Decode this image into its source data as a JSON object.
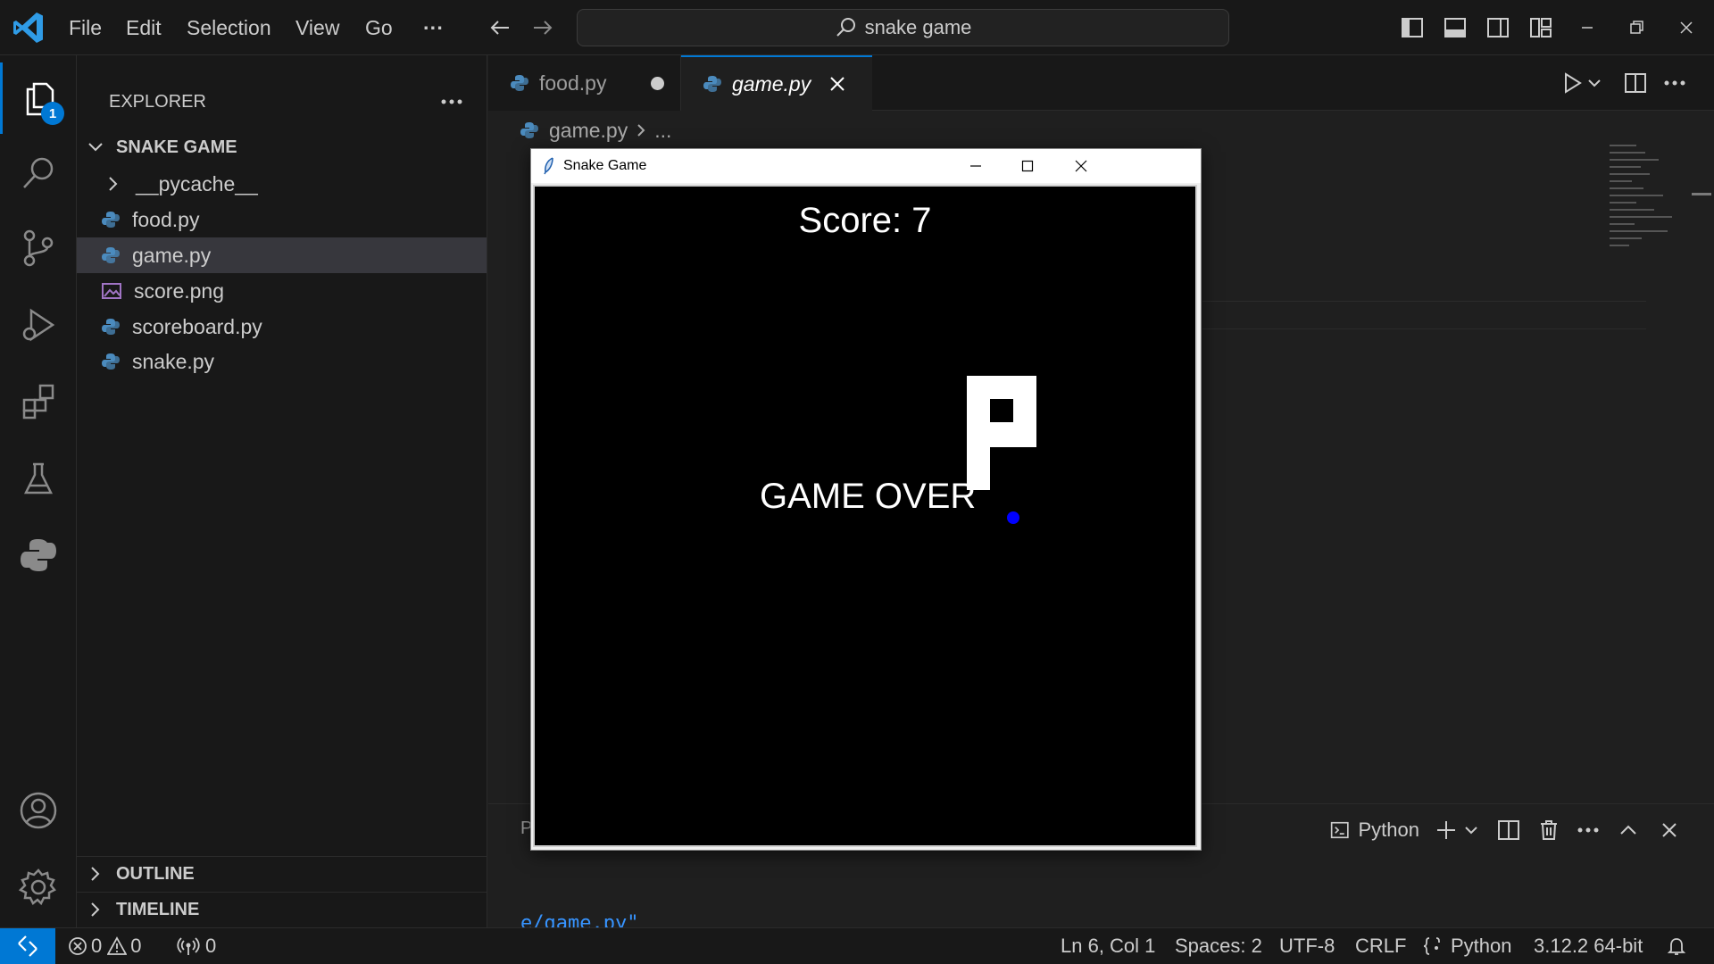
{
  "titlebar": {
    "menu": [
      "File",
      "Edit",
      "Selection",
      "View",
      "Go"
    ],
    "more": "···",
    "search_text": "snake game"
  },
  "activitybar": {
    "explorer_badge": "1",
    "items": [
      "files-icon",
      "search-icon",
      "source-control-icon",
      "run-debug-icon",
      "extensions-icon",
      "testing-icon",
      "python-icon",
      "account-icon",
      "settings-gear-icon"
    ]
  },
  "sidebar": {
    "title": "EXPLORER",
    "folder": "SNAKE GAME",
    "files": [
      {
        "name": "__pycache__",
        "type": "folder"
      },
      {
        "name": "food.py",
        "type": "python"
      },
      {
        "name": "game.py",
        "type": "python",
        "selected": true
      },
      {
        "name": "score.png",
        "type": "image"
      },
      {
        "name": "scoreboard.py",
        "type": "python"
      },
      {
        "name": "snake.py",
        "type": "python"
      }
    ],
    "outline": "OUTLINE",
    "timeline": "TIMELINE"
  },
  "editor": {
    "tabs": [
      {
        "label": "food.py",
        "modified": true
      },
      {
        "label": "game.py",
        "active": true
      }
    ],
    "breadcrumb": {
      "file": "game.py",
      "rest": "..."
    }
  },
  "game_window": {
    "title": "Snake Game",
    "score_text": "Score: 7",
    "game_over_text": "GAME OVER"
  },
  "panel": {
    "terminal_label": "Python",
    "partial_letter": "P",
    "terminal_line": "e/game.py\""
  },
  "statusbar": {
    "errors": "0",
    "warnings": "0",
    "ports": "0",
    "position": "Ln 6, Col 1",
    "spaces": "Spaces: 2",
    "encoding": "UTF-8",
    "eol": "CRLF",
    "language": "Python",
    "interpreter": "3.12.2 64-bit"
  },
  "colors": {
    "accent": "#0078d4",
    "snake_food": "#0000ff",
    "python_blue": "#4b8bbe",
    "python_yellow": "#ffd43b"
  }
}
